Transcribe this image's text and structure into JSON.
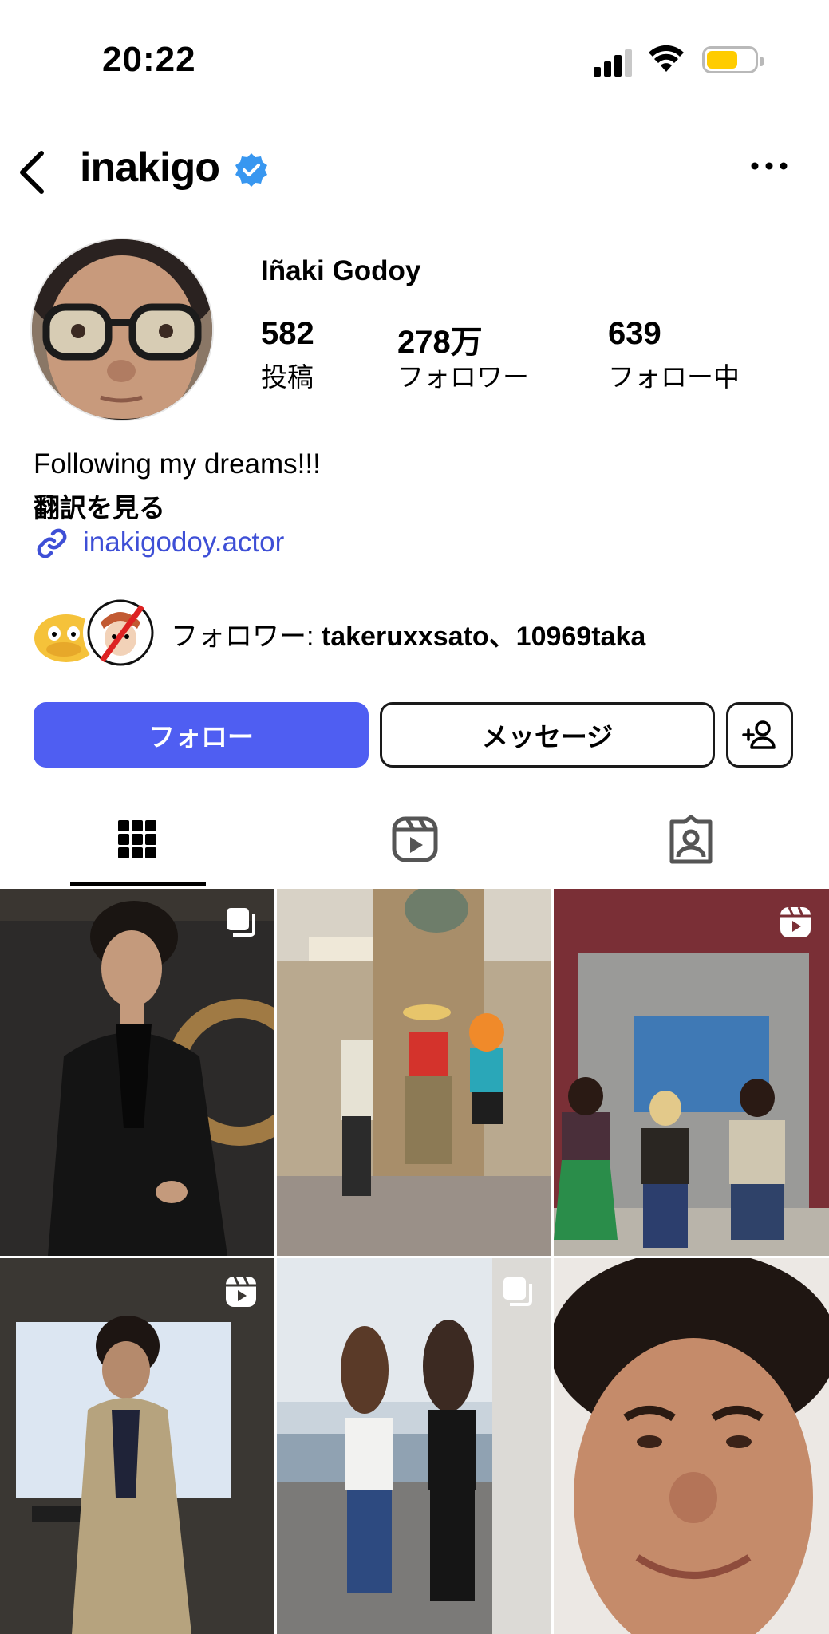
{
  "status_bar": {
    "time": "20:22"
  },
  "header": {
    "username": "inakigo"
  },
  "profile": {
    "full_name": "Iñaki Godoy",
    "stats": [
      {
        "value": "582",
        "label": "投稿"
      },
      {
        "value": "278万",
        "label": "フォロワー"
      },
      {
        "value": "639",
        "label": "フォロー中"
      }
    ],
    "bio": "Following my dreams!!!",
    "translate_label": "翻訳を見る",
    "link": "inakigodoy.actor",
    "mutual_prefix": "フォロワー: ",
    "mutual_names": "takeruxxsato、10969taka"
  },
  "actions": {
    "follow_label": "フォロー",
    "message_label": "メッセージ"
  },
  "tabs": [
    {
      "name": "posts",
      "icon": "grid-icon",
      "active": true
    },
    {
      "name": "reels",
      "icon": "reels-icon",
      "active": false
    },
    {
      "name": "tagged",
      "icon": "tagged-person-icon",
      "active": false
    }
  ],
  "grid": [
    {
      "badge": "carousel-icon"
    },
    {
      "badge": ""
    },
    {
      "badge": "reels-icon"
    },
    {
      "badge": "reels-icon"
    },
    {
      "badge": "carousel-icon"
    },
    {
      "badge": ""
    }
  ]
}
